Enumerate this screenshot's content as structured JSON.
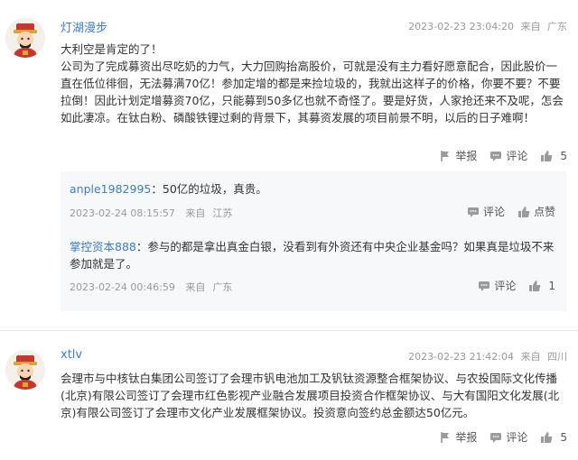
{
  "posts": [
    {
      "username": "灯湖漫步",
      "datetime": "2023-02-23 23:04:20",
      "source_prefix": "来自",
      "location": "广东",
      "content_line1": "大利空是肯定的了！",
      "content_body": "公司为了完成募资出尽吃奶的力气，大力回购抬高股价，可就是没有主力看好愿意配合，因此股价一直在低位徘徊，无法募满70亿！参加定增的都是来捡垃圾的，我就出这样子的价格，你要不要？不要拉倒！因此计划定增募资70亿，只能募到50多亿也就不奇怪了。要是好货，人家抢还来不及呢，怎会如此凄凉。在钛白粉、磷酸铁锂过剩的背景下，其募资发展的项目前景不明，以后的日子难啊！",
      "report_label": "举报",
      "comment_label": "评论",
      "likes": "5",
      "replies": [
        {
          "username": "anple1982995",
          "separator": "：",
          "text": "50亿的垃圾，真贵。",
          "datetime": "2023-02-24 08:15:57",
          "source_prefix": "来自",
          "location": "江苏",
          "comment_label": "评论",
          "like_label": "点赞"
        },
        {
          "username": "掌控资本888",
          "separator": "：",
          "text": "参与的都是拿出真金白银，没看到有外资还有中央企业基金吗？如果真是垃圾不来参加就是了。",
          "datetime": "2023-02-24 00:46:59",
          "source_prefix": "来自",
          "location": "广东",
          "comment_label": "评论",
          "likes": "1"
        }
      ]
    },
    {
      "username": "xtlv",
      "datetime": "2023-02-23 21:42:04",
      "source_prefix": "来自",
      "location": "四川",
      "content_body": "会理市与中核钛白集团公司签订了会理市钒电池加工及钒钛资源整合框架协议、与农投国际文化传播(北京)有限公司签订了会理市红色影视产业融合发展项目投资合作框架协议、与大有国阳文化发展(北京)有限公司签订了会理市文化产业发展框架协议。投资意向签约总金额达50亿元。",
      "report_label": "举报",
      "comment_label": "评论",
      "likes": "5"
    }
  ],
  "icons": {
    "avatar": "caishen-avatar-icon",
    "report": "flag-icon",
    "comment": "comment-bubble-icon",
    "like": "thumbs-up-icon"
  },
  "colors": {
    "link": "#3d7cc9",
    "meta": "#999999",
    "reply_bg": "#f7f8fa"
  }
}
